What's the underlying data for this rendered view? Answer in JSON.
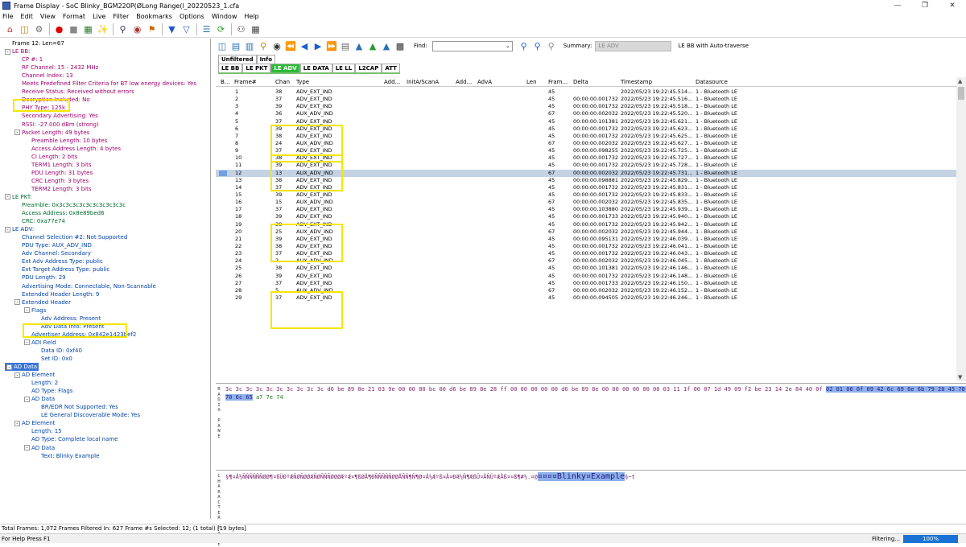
{
  "window": {
    "title": "Frame Display - SoC Blinky_BGM220P(ØLong Range(l_20220523_1.cfa",
    "minimize": "—",
    "maximize": "❐",
    "close": "✕"
  },
  "menu": [
    "File",
    "Edit",
    "View",
    "Format",
    "Live",
    "Filter",
    "Bookmarks",
    "Options",
    "Window",
    "Help"
  ],
  "toolbar_icons": [
    "home-icon",
    "folder-icon",
    "gear-icon",
    "record-icon",
    "stop-icon",
    "save-icon",
    "wand-icon",
    "find-icon",
    "binoculars-icon",
    "bookmark-icon",
    "filter-icon",
    "filter-edit-icon",
    "layers-icon",
    "refresh-icon",
    "people-icon",
    "grid-icon"
  ],
  "tree": [
    {
      "t": "Frame 12:  Len=67",
      "lvl": 0,
      "c": "blk",
      "exp": false
    },
    {
      "t": "LE BB:",
      "lvl": 0,
      "c": "mag",
      "exp": true
    },
    {
      "t": "CP #: 1",
      "lvl": 1,
      "c": "mag"
    },
    {
      "t": "RF Channel: 15 - 2432 MHz",
      "lvl": 1,
      "c": "mag"
    },
    {
      "t": "Channel Index: 13",
      "lvl": 1,
      "c": "mag"
    },
    {
      "t": "Meets Predefined Filter Criteria for BT low energy devices: Yes",
      "lvl": 1,
      "c": "mag"
    },
    {
      "t": "Receive Status: Received without errors",
      "lvl": 1,
      "c": "mag"
    },
    {
      "t": "Decryption Included: No",
      "lvl": 1,
      "c": "mag"
    },
    {
      "t": "PHY Type: 125k",
      "lvl": 1,
      "c": "mag"
    },
    {
      "t": "Secondary Advertising: Yes",
      "lvl": 1,
      "c": "mag"
    },
    {
      "t": "RSSI: -27.000 dBm (strong)",
      "lvl": 1,
      "c": "mag"
    },
    {
      "t": "Packet Length: 49  bytes",
      "lvl": 1,
      "c": "mag",
      "exp": true
    },
    {
      "t": "Preamble Length: 10 bytes",
      "lvl": 2,
      "c": "mag"
    },
    {
      "t": "Access Address Length: 4 bytes",
      "lvl": 2,
      "c": "mag"
    },
    {
      "t": "CI Length: 2 bits",
      "lvl": 2,
      "c": "mag"
    },
    {
      "t": "TERM1 Length: 3 bits",
      "lvl": 2,
      "c": "mag"
    },
    {
      "t": "PDU Length: 31 bytes",
      "lvl": 2,
      "c": "mag"
    },
    {
      "t": "CRC Length: 3 bytes",
      "lvl": 2,
      "c": "mag"
    },
    {
      "t": "TERM2 Length: 3 bits",
      "lvl": 2,
      "c": "mag"
    },
    {
      "t": "LE PKT:",
      "lvl": 0,
      "c": "grn",
      "exp": true
    },
    {
      "t": "Preamble: 0x3c3c3c3c3c3c3c3c3c3c",
      "lvl": 1,
      "c": "grn"
    },
    {
      "t": "Access Address: 0x8e89bed6",
      "lvl": 1,
      "c": "grn"
    },
    {
      "t": "CRC: 0xa77e74",
      "lvl": 1,
      "c": "grn"
    },
    {
      "t": "LE ADV:",
      "lvl": 0,
      "c": "blu",
      "exp": true
    },
    {
      "t": "Channel Selection #2: Not Supported",
      "lvl": 1,
      "c": "blu"
    },
    {
      "t": "PDU Type: AUX_ADV_IND",
      "lvl": 1,
      "c": "blu"
    },
    {
      "t": "Adv Channel: Secondary",
      "lvl": 1,
      "c": "blu"
    },
    {
      "t": "Ext Adv Address Type: public",
      "lvl": 1,
      "c": "blu"
    },
    {
      "t": "Ext Target Address Type: public",
      "lvl": 1,
      "c": "blu"
    },
    {
      "t": "PDU Length: 29",
      "lvl": 1,
      "c": "blu"
    },
    {
      "t": "Advertising Mode: Connectable, Non-Scannable",
      "lvl": 1,
      "c": "blu"
    },
    {
      "t": "Extended Header Length: 9",
      "lvl": 1,
      "c": "blu"
    },
    {
      "t": "Extended Header",
      "lvl": 1,
      "c": "blu",
      "exp": true
    },
    {
      "t": "Flags",
      "lvl": 2,
      "c": "blu",
      "exp": true
    },
    {
      "t": "Adv Address: Present",
      "lvl": 3,
      "c": "blu"
    },
    {
      "t": "Adv Data Info: Present",
      "lvl": 3,
      "c": "blu"
    },
    {
      "t": "Advertiser Address: 0x842e1423bef2",
      "lvl": 2,
      "c": "blu"
    },
    {
      "t": "ADI Field",
      "lvl": 2,
      "c": "blu",
      "exp": true
    },
    {
      "t": "Data ID: 0xf40",
      "lvl": 3,
      "c": "blu"
    },
    {
      "t": "Set ID: 0x0",
      "lvl": 3,
      "c": "blu"
    },
    {
      "t": "AD Data",
      "lvl": 0,
      "c": "blu",
      "exp": true,
      "sel": true
    },
    {
      "t": "AD Element",
      "lvl": 1,
      "c": "blu",
      "exp": true
    },
    {
      "t": "Length: 2",
      "lvl": 2,
      "c": "blu"
    },
    {
      "t": "AD Type: Flags",
      "lvl": 2,
      "c": "blu"
    },
    {
      "t": "AD Data",
      "lvl": 2,
      "c": "blu",
      "exp": true
    },
    {
      "t": "BR/EDR Not Supported: Yes",
      "lvl": 3,
      "c": "blu"
    },
    {
      "t": "LE General Discoverable Mode: Yes",
      "lvl": 3,
      "c": "blu"
    },
    {
      "t": "AD Element",
      "lvl": 1,
      "c": "blu",
      "exp": true
    },
    {
      "t": "Length: 15",
      "lvl": 2,
      "c": "blu"
    },
    {
      "t": "AD Type: Complete local name",
      "lvl": 2,
      "c": "blu"
    },
    {
      "t": "AD Data",
      "lvl": 2,
      "c": "blu",
      "exp": true
    },
    {
      "t": "Text: Blinky Example",
      "lvl": 3,
      "c": "blu"
    }
  ],
  "right_toolbar": {
    "find_label": "Find:",
    "find_value": "",
    "find_dropdown": "⌄",
    "summary_label": "Summary:",
    "summary_value": "LE ADV",
    "auto_traverse": "LE BB with Auto-traverse"
  },
  "view_tabs": [
    "Unfiltered",
    "Info"
  ],
  "protocol_tabs": [
    "LE BB",
    "LE PKT",
    "LE ADV",
    "LE DATA",
    "LE LL",
    "L2CAP",
    "ATT"
  ],
  "active_protocol_tab": "LE ADV",
  "columns": [
    "B...",
    "Frame#",
    "Chan",
    "Type",
    "Add...",
    "InitA/ScanA",
    "Add...",
    "AdvA",
    "Len",
    "Fram...",
    "Delta",
    "Timestamp",
    "Datasource"
  ],
  "rows": [
    [
      "1",
      "38",
      "ADV_EXT_IND",
      "45",
      "",
      "2022/05/23 19:22:45.514..."
    ],
    [
      "2",
      "37",
      "ADV_EXT_IND",
      "45",
      "00:00:00.001732",
      "2022/05/23 19:22:45.516..."
    ],
    [
      "3",
      "39",
      "ADV_EXT_IND",
      "45",
      "00:00:00.001732",
      "2022/05/23 19:22:45.518..."
    ],
    [
      "4",
      "36",
      "AUX_ADV_IND",
      "67",
      "00:00:00.002032",
      "2022/05/23 19:22:45.520..."
    ],
    [
      "5",
      "37",
      "ADV_EXT_IND",
      "45",
      "00:00:00.101381",
      "2022/05/23 19:22:45.621..."
    ],
    [
      "6",
      "39",
      "ADV_EXT_IND",
      "45",
      "00:00:00.001732",
      "2022/05/23 19:22:45.623..."
    ],
    [
      "7",
      "38",
      "ADV_EXT_IND",
      "45",
      "00:00:00.001732",
      "2022/05/23 19:22:45.625..."
    ],
    [
      "8",
      "24",
      "AUX_ADV_IND",
      "67",
      "00:00:00.002032",
      "2022/05/23 19:22:45.627..."
    ],
    [
      "9",
      "37",
      "ADV_EXT_IND",
      "45",
      "00:00:00.098255",
      "2022/05/23 19:22:45.725..."
    ],
    [
      "10",
      "38",
      "ADV_EXT_IND",
      "45",
      "00:00:00.001732",
      "2022/05/23 19:22:45.727..."
    ],
    [
      "11",
      "39",
      "ADV_EXT_IND",
      "45",
      "00:00:00.001732",
      "2022/05/23 19:22:45.728..."
    ],
    [
      "12",
      "13",
      "AUX_ADV_IND",
      "67",
      "00:00:00.002032",
      "2022/05/23 19:22:45.731..."
    ],
    [
      "13",
      "38",
      "ADV_EXT_IND",
      "45",
      "00:00:00.098881",
      "2022/05/23 19:22:45.829..."
    ],
    [
      "14",
      "37",
      "ADV_EXT_IND",
      "45",
      "00:00:00.001732",
      "2022/05/23 19:22:45.831..."
    ],
    [
      "15",
      "39",
      "ADV_EXT_IND",
      "45",
      "00:00:00.001732",
      "2022/05/23 19:22:45.833..."
    ],
    [
      "16",
      "15",
      "AUX_ADV_IND",
      "67",
      "00:00:00.002032",
      "2022/05/23 19:22:45.835..."
    ],
    [
      "17",
      "37",
      "ADV_EXT_IND",
      "45",
      "00:00:00.103880",
      "2022/05/23 19:22:45.939..."
    ],
    [
      "18",
      "39",
      "ADV_EXT_IND",
      "45",
      "00:00:00.001733",
      "2022/05/23 19:22:45.940..."
    ],
    [
      "19",
      "38",
      "ADV_EXT_IND",
      "45",
      "00:00:00.001732",
      "2022/05/23 19:22:45.942..."
    ],
    [
      "20",
      "25",
      "AUX_ADV_IND",
      "67",
      "00:00:00.002032",
      "2022/05/23 19:22:45.944..."
    ],
    [
      "21",
      "39",
      "ADV_EXT_IND",
      "45",
      "00:00:00.095131",
      "2022/05/23 19:22:46.039..."
    ],
    [
      "22",
      "38",
      "ADV_EXT_IND",
      "45",
      "00:00:00.001732",
      "2022/05/23 19:22:46.041..."
    ],
    [
      "23",
      "37",
      "ADV_EXT_IND",
      "45",
      "00:00:00.001732",
      "2022/05/23 19:22:46.043..."
    ],
    [
      "24",
      "2",
      "AUX_ADV_IND",
      "67",
      "00:00:00.002032",
      "2022/05/23 19:22:46.045..."
    ],
    [
      "25",
      "38",
      "ADV_EXT_IND",
      "45",
      "00:00:00.101381",
      "2022/05/23 19:22:46.146..."
    ],
    [
      "26",
      "39",
      "ADV_EXT_IND",
      "45",
      "00:00:00.001732",
      "2022/05/23 19:22:46.148..."
    ],
    [
      "27",
      "37",
      "ADV_EXT_IND",
      "45",
      "00:00:00.001733",
      "2022/05/23 19:22:46.150..."
    ],
    [
      "28",
      "5",
      "AUX_ADV_IND",
      "67",
      "00:00:00.002032",
      "2022/05/23 19:22:46.152..."
    ],
    [
      "29",
      "37",
      "ADV_EXT_IND",
      "45",
      "00:00:00.094505",
      "2022/05/23 19:22:46.246..."
    ]
  ],
  "datasource": "1 - Bluetooth LE",
  "selected_frame": "12",
  "raw_pane": {
    "label": "RADIX PANE",
    "line1_plain": "3c 3c 3c 3c 3c 3c 3c 3c 3c 3c d6 be 89 8e 21 03 9e 00 00 80 bc 00 d6 be 89 8e 28 ff 00 00 00 00 00 d6 be 89 8e 00 00 00 00 00 00 03 11 1f 00 07 1d 49 09 f2 be 23 14 2e 84 40 0f",
    "line1_sel": "02 01 06 0f 09 42 6c 69 6e 6b 79 20 45 78 61 6d",
    "line2_sel": "70 6c 65",
    "line2_grn": "a7 7e 74"
  },
  "char_pane": {
    "label": "CHARACTER PANE",
    "prefix": "§¶¤Å½ÑÑÑÑÑÑØØ¶¤ßÜÐºÆÑØÑØØÆÑØÑÑÑØØØÆºÆ¤¶ßØÅ¶ÐÑÑÑÑÑØØÅÑÑ¶Ñ¶Ø¤Å½Æºß¤Å¤ÐÆ½Ñ¶ÆßÜ¤ÅÑÜºÆÅß¤¤ß¶#½.¤@",
    "sel_prefix": "¤¤¤¤",
    "sel_text": "Blinky¤Example",
    "suffix": "§~t"
  },
  "status": {
    "line1": "Total Frames:  1,072   Frames Filtered In:  627   Frame #s Selected:  12; (1 total) [19 bytes]",
    "help": "For Help Press F1",
    "filtering": "Filtering...",
    "progress_label": "100%",
    "progress_value": 100
  }
}
